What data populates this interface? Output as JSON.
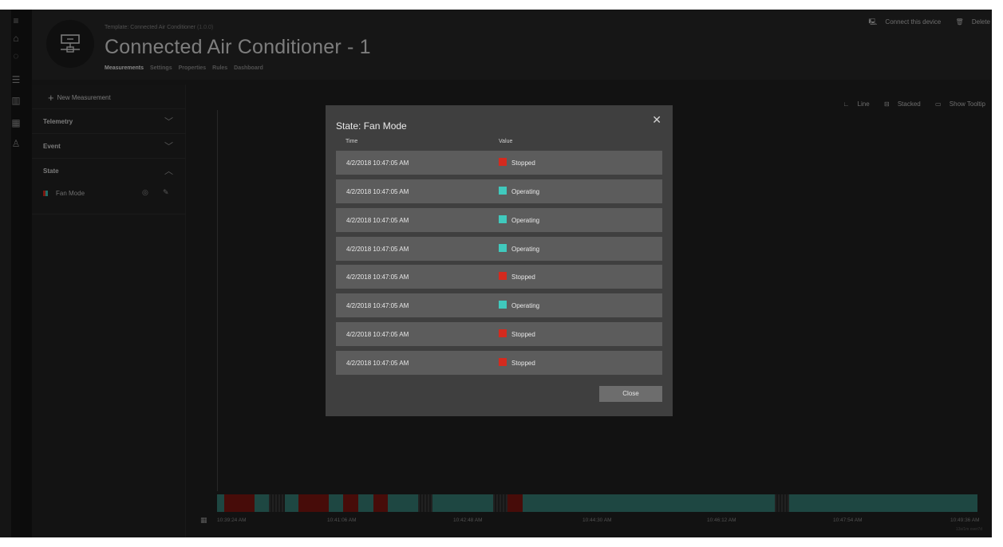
{
  "nav": {
    "icons": [
      "menu-icon",
      "home-icon",
      "devices-icon",
      "list-icon",
      "analytics-icon",
      "apps-icon",
      "users-icon"
    ]
  },
  "header": {
    "template_label": "Template: Connected Air Conditioner",
    "template_version": "(1.0.0)",
    "device_name": "Connected Air Conditioner - 1",
    "tabs": [
      {
        "label": "Measurements",
        "active": true
      },
      {
        "label": "Settings",
        "active": false
      },
      {
        "label": "Properties",
        "active": false
      },
      {
        "label": "Rules",
        "active": false
      },
      {
        "label": "Dashboard",
        "active": false
      }
    ],
    "actions": {
      "connect_label": "Connect this device",
      "delete_label": "Delete"
    }
  },
  "sidepanel": {
    "new_measurement_label": "New Measurement",
    "sections": [
      {
        "label": "Telemetry",
        "expanded": false
      },
      {
        "label": "Event",
        "expanded": false
      },
      {
        "label": "State",
        "expanded": true
      }
    ],
    "state_items": [
      {
        "label": "Fan Mode"
      }
    ]
  },
  "chart": {
    "options": {
      "line_label": "Line",
      "stacked_label": "Stacked",
      "tooltip_label": "Show Tooltip"
    },
    "ticks": [
      "10:39:24 AM",
      "10:41:06 AM",
      "10:42:48 AM",
      "10:44:30 AM",
      "10:46:12 AM",
      "10:47:54 AM",
      "10:49:36 AM"
    ],
    "note": "13s/1m over7d",
    "colors": {
      "stopped": "#7b1510",
      "operating": "#347a72"
    }
  },
  "modal": {
    "title": "State: Fan Mode",
    "time_header": "Time",
    "value_header": "Value",
    "close_label": "Close",
    "rows": [
      {
        "time": "4/2/2018 10:47:05 AM",
        "value": "Stopped",
        "color": "#d42a1e"
      },
      {
        "time": "4/2/2018 10:47:05 AM",
        "value": "Operating",
        "color": "#40c9bd"
      },
      {
        "time": "4/2/2018 10:47:05 AM",
        "value": "Operating",
        "color": "#40c9bd"
      },
      {
        "time": "4/2/2018 10:47:05 AM",
        "value": "Operating",
        "color": "#40c9bd"
      },
      {
        "time": "4/2/2018 10:47:05 AM",
        "value": "Stopped",
        "color": "#d42a1e"
      },
      {
        "time": "4/2/2018 10:47:05 AM",
        "value": "Operating",
        "color": "#40c9bd"
      },
      {
        "time": "4/2/2018 10:47:05 AM",
        "value": "Stopped",
        "color": "#d42a1e"
      },
      {
        "time": "4/2/2018 10:47:05 AM",
        "value": "Stopped",
        "color": "#d42a1e"
      }
    ]
  }
}
